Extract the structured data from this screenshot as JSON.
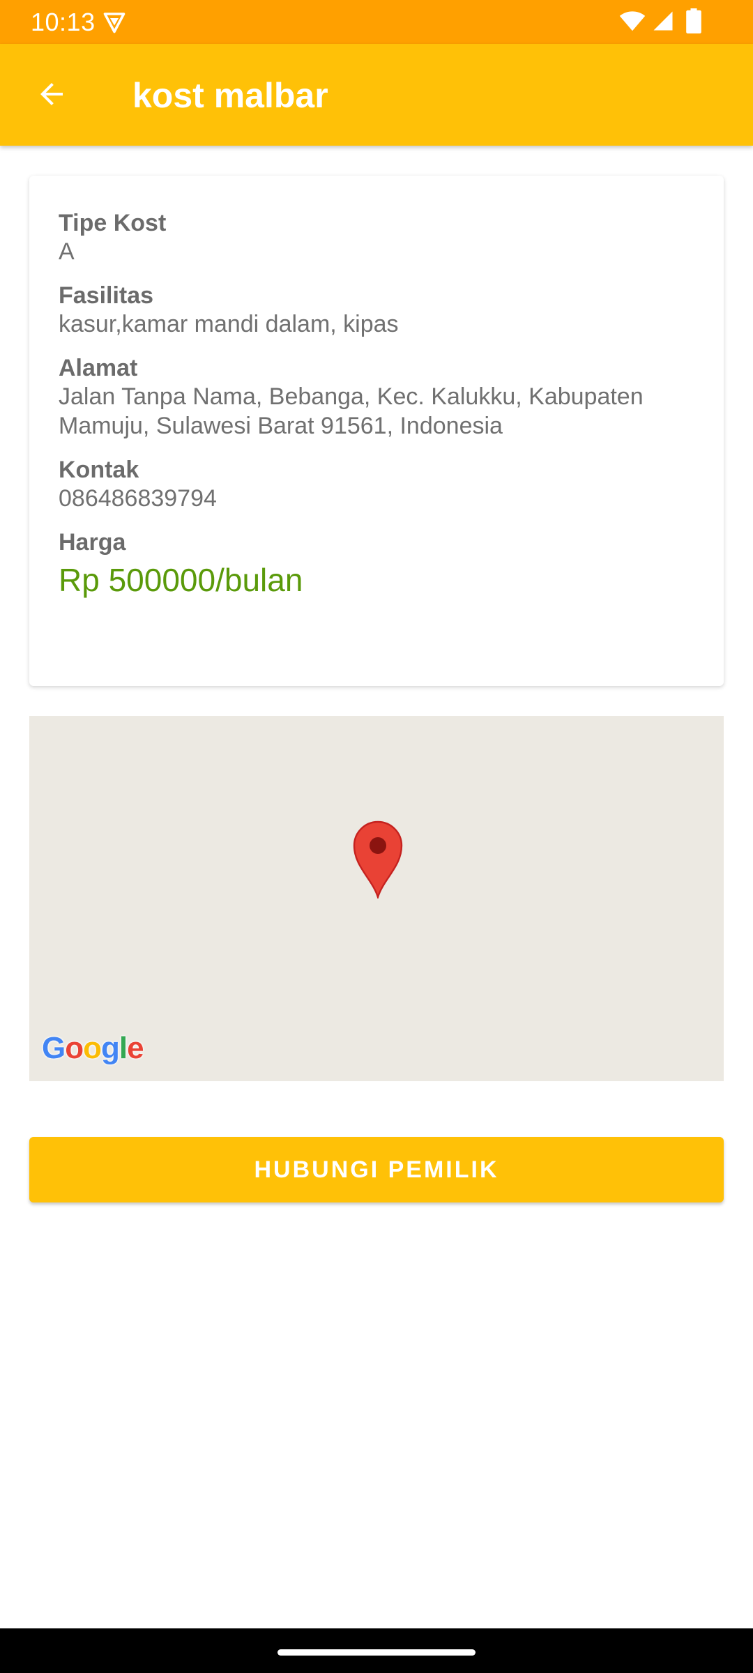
{
  "status_bar": {
    "time": "10:13",
    "icons": [
      "vpn-shield-icon",
      "wifi-icon",
      "cell-signal-icon",
      "battery-icon"
    ]
  },
  "app_bar": {
    "title": "kost malbar",
    "back_icon": "arrow-back-icon",
    "color": "#FFC107"
  },
  "details": {
    "fields": [
      {
        "label": "Tipe Kost",
        "value": "A"
      },
      {
        "label": "Fasilitas",
        "value": "kasur,kamar mandi dalam, kipas"
      },
      {
        "label": "Alamat",
        "value": "Jalan Tanpa Nama, Bebanga, Kec. Kalukku, Kabupaten Mamuju, Sulawesi Barat 91561, Indonesia"
      },
      {
        "label": "Kontak",
        "value": "086486839794"
      },
      {
        "label": "Harga",
        "value": "Rp 500000/bulan"
      }
    ],
    "price_color": "#5a9a0a"
  },
  "map": {
    "logo_text": "Google",
    "marker_icon": "map-pin-icon",
    "background": "#ECE9E2"
  },
  "contact_button": {
    "label": "HUBUNGI PEMILIK"
  }
}
